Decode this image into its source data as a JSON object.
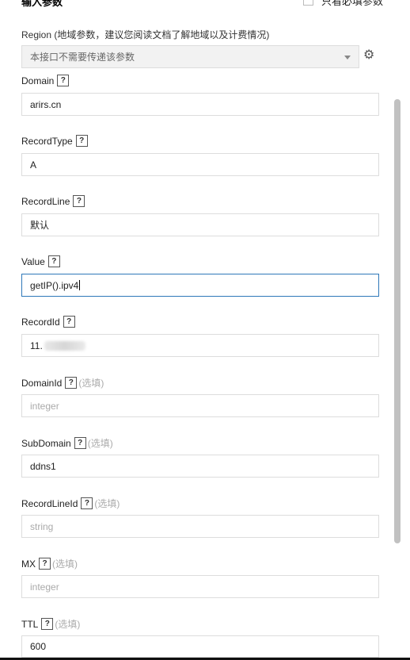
{
  "header": {
    "title": "输入参数",
    "only_required_label": "只看必填参数"
  },
  "region": {
    "label": "Region (地域参数，建议您阅读文档了解地域以及计费情况)",
    "value": "本接口不需要传递该参数"
  },
  "help_icon": "?",
  "optional_text": "(选填)",
  "fields": [
    {
      "label": "Domain",
      "value": "arirs.cn",
      "optional": false
    },
    {
      "label": "RecordType",
      "value": "A",
      "optional": false
    },
    {
      "label": "RecordLine",
      "value": "默认",
      "optional": false
    },
    {
      "label": "Value",
      "value": "getIP().ipv4",
      "optional": false,
      "focused": true
    },
    {
      "label": "RecordId",
      "value": "11.",
      "optional": false,
      "redacted": true
    },
    {
      "label": "DomainId",
      "placeholder": "integer",
      "optional": true
    },
    {
      "label": "SubDomain",
      "value": "ddns1",
      "optional": true
    },
    {
      "label": "RecordLineId",
      "placeholder": "string",
      "optional": true
    },
    {
      "label": "MX",
      "placeholder": "integer",
      "optional": true
    },
    {
      "label": "TTL",
      "value": "600",
      "optional": true
    }
  ]
}
